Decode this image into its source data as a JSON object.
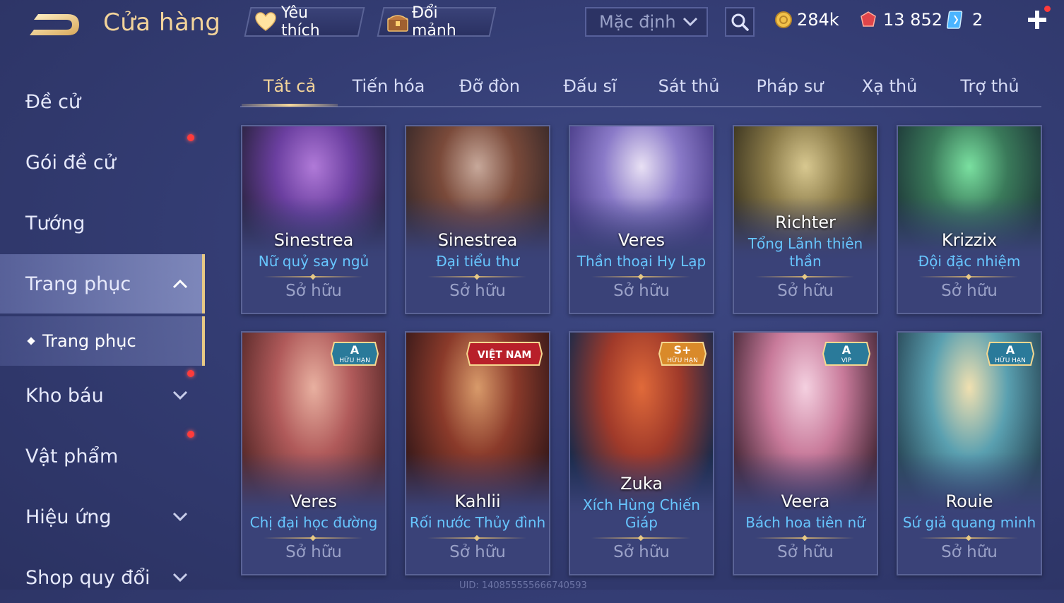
{
  "header": {
    "title": "Cửa hàng",
    "favorite_label": "Yêu thích",
    "exchange_label": "Đổi mảnh",
    "sort_label": "Mặc định",
    "gold": "284k",
    "vouchers": "13 852",
    "tickets": "2"
  },
  "sidebar": {
    "items": [
      {
        "label": "Đề cử"
      },
      {
        "label": "Gói đề cử"
      },
      {
        "label": "Tướng"
      },
      {
        "label": "Trang phục"
      },
      {
        "label": "Kho báu"
      },
      {
        "label": "Vật phẩm"
      },
      {
        "label": "Hiệu ứng"
      },
      {
        "label": "Shop quy đổi"
      }
    ],
    "sub_item": "Trang phục"
  },
  "tabs": [
    "Tất cả",
    "Tiến hóa",
    "Đỡ đòn",
    "Đấu sĩ",
    "Sát thủ",
    "Pháp sư",
    "Xạ thủ",
    "Trợ thủ"
  ],
  "cards": [
    {
      "hero": "Sinestrea",
      "skin": "Nữ quỷ say ngủ",
      "status": "Sở hữu",
      "colors": [
        "#2a2340",
        "#6b3fa0",
        "#b07ad8"
      ]
    },
    {
      "hero": "Sinestrea",
      "skin": "Đại tiểu thư",
      "status": "Sở hữu",
      "colors": [
        "#3a2a2a",
        "#7a4a3a",
        "#c7a89a"
      ]
    },
    {
      "hero": "Veres",
      "skin": "Thần thoại Hy Lạp",
      "status": "Sở hữu",
      "colors": [
        "#4b3e8a",
        "#8a7ac8",
        "#e8e0f4"
      ]
    },
    {
      "hero": "Richter",
      "skin": "Tổng Lãnh thiên thần",
      "status": "Sở hữu",
      "colors": [
        "#3a3420",
        "#8a7a48",
        "#d8c890"
      ]
    },
    {
      "hero": "Krizzix",
      "skin": "Đội đặc nhiệm",
      "status": "Sở hữu",
      "colors": [
        "#1f3a3a",
        "#3a7a5a",
        "#7ae0a0"
      ]
    },
    {
      "hero": "Veres",
      "skin": "Chị đại học đường",
      "status": "Sở hữu",
      "colors": [
        "#5a2a2a",
        "#b05a5a",
        "#e8b0a0"
      ],
      "badge": "A",
      "badge_sub": "HỮU HẠN"
    },
    {
      "hero": "Kahlii",
      "skin": "Rối nước Thủy đình",
      "status": "Sở hữu",
      "colors": [
        "#3a1a1a",
        "#8a3a2a",
        "#d89a6a"
      ],
      "badge": "VIỆT NAM"
    },
    {
      "hero": "Zuka",
      "skin": "Xích Hùng Chiến Giáp",
      "status": "Sở hữu",
      "colors": [
        "#1a2a4a",
        "#a03a2a",
        "#e06a3a"
      ],
      "badge": "S+",
      "badge_sub": "HỮU HẠN"
    },
    {
      "hero": "Veera",
      "skin": "Bách hoa tiên nữ",
      "status": "Sở hữu",
      "colors": [
        "#4a2a3a",
        "#c87a9a",
        "#f4d0e0"
      ],
      "badge": "A",
      "badge_sub": "VIP"
    },
    {
      "hero": "Rouie",
      "skin": "Sứ giả quang minh",
      "status": "Sở hữu",
      "colors": [
        "#2a4a5a",
        "#5aa0b0",
        "#f0e0b0"
      ],
      "badge": "A",
      "badge_sub": "HỮU HẠN"
    }
  ],
  "uid_text": "UID: 140855555666740593",
  "colors": {
    "accent_gold": "#f2d39a",
    "skin_blue": "#67c6ff",
    "red_dot": "#ff3b3b"
  }
}
